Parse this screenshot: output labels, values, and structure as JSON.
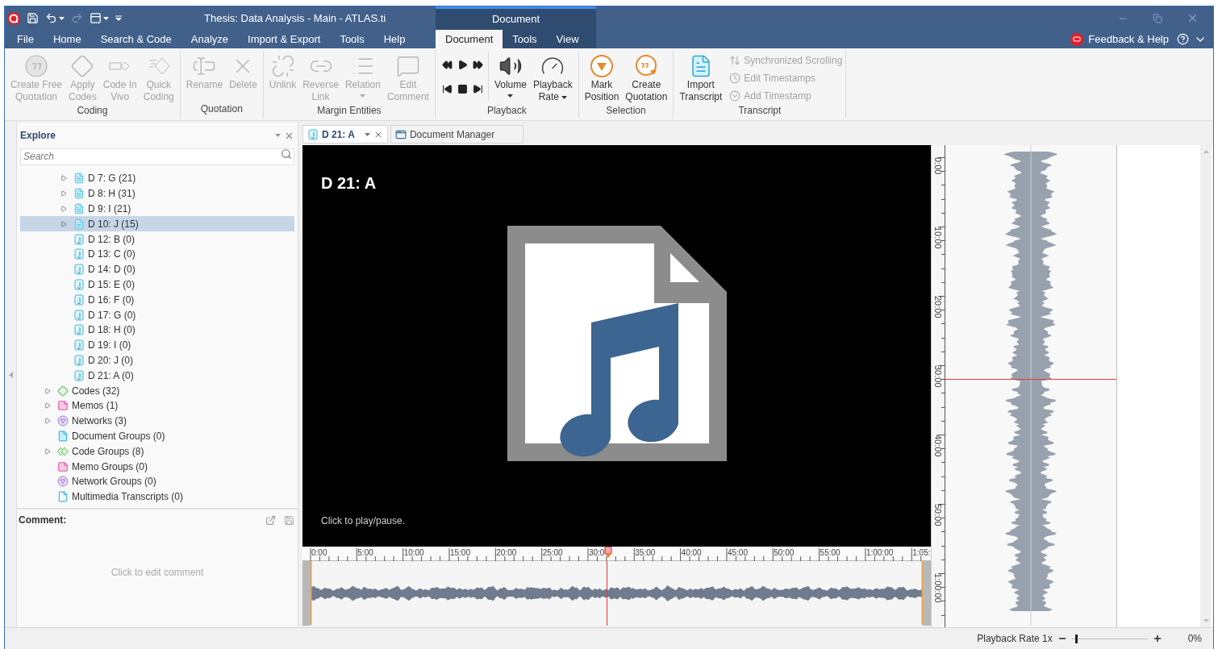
{
  "window": {
    "title": "Thesis: Data Analysis - Main - ATLAS.ti",
    "context_group": "Document"
  },
  "menu_tabs": [
    {
      "label": "File",
      "selected": false,
      "context": false
    },
    {
      "label": "Home",
      "selected": false,
      "context": false
    },
    {
      "label": "Search & Code",
      "selected": false,
      "context": false
    },
    {
      "label": "Analyze",
      "selected": false,
      "context": false
    },
    {
      "label": "Import & Export",
      "selected": false,
      "context": false
    },
    {
      "label": "Tools",
      "selected": false,
      "context": false
    },
    {
      "label": "Help",
      "selected": false,
      "context": false
    },
    {
      "label": "Document",
      "selected": true,
      "context": true
    },
    {
      "label": "Tools",
      "selected": false,
      "context": true
    },
    {
      "label": "View",
      "selected": false,
      "context": true
    }
  ],
  "feedback": "Feedback & Help",
  "ribbon": [
    {
      "label": "Coding",
      "kind": "standard",
      "buttons": [
        {
          "label": "Create Free\nQuotation",
          "disabled": true,
          "dropdown": false
        },
        {
          "label": "Apply\nCodes",
          "disabled": true,
          "dropdown": false
        },
        {
          "label": "Code In\nVivo",
          "disabled": true,
          "dropdown": false
        },
        {
          "label": "Quick\nCoding",
          "disabled": true,
          "dropdown": false
        }
      ]
    },
    {
      "label": "Quotation",
      "kind": "standard",
      "buttons": [
        {
          "label": "Rename",
          "disabled": true,
          "dropdown": false
        },
        {
          "label": "Delete",
          "disabled": true,
          "dropdown": false
        }
      ]
    },
    {
      "label": "Margin Entities",
      "kind": "standard",
      "buttons": [
        {
          "label": "Unlink",
          "disabled": true,
          "dropdown": false
        },
        {
          "label": "Reverse\nLink",
          "disabled": true,
          "dropdown": false
        },
        {
          "label": "Relation",
          "disabled": true,
          "dropdown": true
        },
        {
          "label": "Edit\nComment",
          "disabled": true,
          "dropdown": false
        }
      ]
    },
    {
      "label": "Playback",
      "kind": "playback",
      "buttons": [
        {
          "label": "Volume",
          "disabled": false,
          "dropdown": true
        },
        {
          "label": "Playback\nRate",
          "disabled": false,
          "dropdown": true
        }
      ]
    },
    {
      "label": "Selection",
      "kind": "standard",
      "buttons": [
        {
          "label": "Mark\nPosition",
          "disabled": false,
          "dropdown": false
        },
        {
          "label": "Create\nQuotation",
          "disabled": false,
          "dropdown": false
        }
      ]
    },
    {
      "label": "Transcript",
      "kind": "transcript",
      "buttons": [
        {
          "label": "Import\nTranscript",
          "disabled": false,
          "dropdown": false
        }
      ],
      "small_buttons": [
        {
          "label": "Synchronized Scrolling",
          "disabled": true
        },
        {
          "label": "Edit Timestamps",
          "disabled": true
        },
        {
          "label": "Add Timestamp",
          "disabled": true
        }
      ]
    }
  ],
  "explore": {
    "title": "Explore",
    "search_placeholder": "Search",
    "documents": [
      {
        "label": "D 7: G (21)",
        "kind": "text",
        "expandable": true,
        "selected": false
      },
      {
        "label": "D 8: H (31)",
        "kind": "text",
        "expandable": true,
        "selected": false
      },
      {
        "label": "D 9: I (21)",
        "kind": "text",
        "expandable": true,
        "selected": false
      },
      {
        "label": "D 10: J (15)",
        "kind": "text",
        "expandable": true,
        "selected": true
      },
      {
        "label": "D 12: B (0)",
        "kind": "audio",
        "expandable": false,
        "selected": false
      },
      {
        "label": "D 13: C (0)",
        "kind": "audio",
        "expandable": false,
        "selected": false
      },
      {
        "label": "D 14: D (0)",
        "kind": "audio",
        "expandable": false,
        "selected": false
      },
      {
        "label": "D 15: E (0)",
        "kind": "audio",
        "expandable": false,
        "selected": false
      },
      {
        "label": "D 16: F (0)",
        "kind": "audio",
        "expandable": false,
        "selected": false
      },
      {
        "label": "D 17: G (0)",
        "kind": "audio",
        "expandable": false,
        "selected": false
      },
      {
        "label": "D 18: H (0)",
        "kind": "audio",
        "expandable": false,
        "selected": false
      },
      {
        "label": "D 19: I (0)",
        "kind": "audio",
        "expandable": false,
        "selected": false
      },
      {
        "label": "D 20: J (0)",
        "kind": "audio",
        "expandable": false,
        "selected": false
      },
      {
        "label": "D 21: A (0)",
        "kind": "audio",
        "expandable": false,
        "selected": false
      }
    ],
    "items": [
      {
        "label": "Codes (32)",
        "kind": "codes",
        "expandable": true,
        "selected": false
      },
      {
        "label": "Memos (1)",
        "kind": "memos",
        "expandable": true,
        "selected": false
      },
      {
        "label": "Networks (3)",
        "kind": "networks",
        "expandable": true,
        "selected": false
      },
      {
        "label": "Document Groups (0)",
        "kind": "document_groups",
        "expandable": false,
        "selected": false
      },
      {
        "label": "Code Groups (8)",
        "kind": "code_groups",
        "expandable": true,
        "selected": false
      },
      {
        "label": "Memo Groups (0)",
        "kind": "memo_groups",
        "expandable": false,
        "selected": false
      },
      {
        "label": "Network Groups (0)",
        "kind": "network_groups",
        "expandable": false,
        "selected": false
      },
      {
        "label": "Multimedia Transcripts (0)",
        "kind": "transcripts",
        "expandable": false,
        "selected": false
      }
    ]
  },
  "comment": {
    "title": "Comment:",
    "placeholder": "Click to edit comment"
  },
  "doc_tabs": [
    {
      "label": "D 21: A",
      "selected": true
    },
    {
      "label": "Document Manager",
      "selected": false
    }
  ],
  "media": {
    "title": "D 21: A",
    "hint": "Click to play/pause."
  },
  "timeline": {
    "labels": [
      "0:00",
      "5:00",
      "10:00",
      "15:00",
      "20:00",
      "25:00",
      "30:0",
      "35:00",
      "40:00",
      "45:00",
      "50:00",
      "55:00",
      "1:00:00",
      "1:05:"
    ],
    "playhead": {
      "level": 0.483
    }
  },
  "vertical_ruler": {
    "labels": [
      "0:00",
      "10:00",
      "20:00",
      "30:00",
      "40:00",
      "50:00",
      "1:00:00"
    ]
  },
  "status_bar": {
    "playback_rate": "Playback Rate 1x",
    "rate_slider": {
      "level": 0.05
    },
    "zoom": "0%"
  }
}
